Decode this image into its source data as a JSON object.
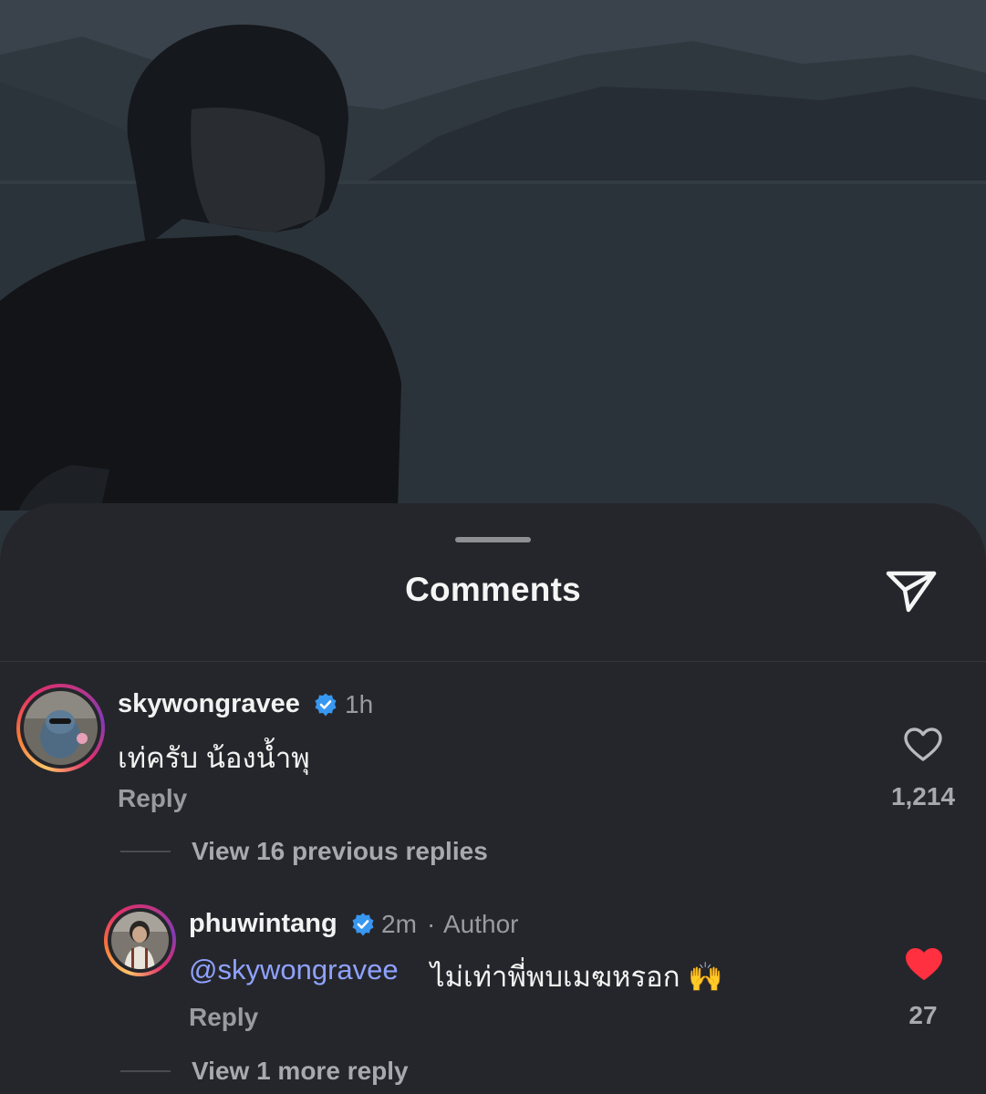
{
  "sheet": {
    "title": "Comments"
  },
  "icons": {
    "share": "paper-plane-icon",
    "like": "heart-icon",
    "verified": "verified-badge-icon",
    "grabber": "drag-handle"
  },
  "colors": {
    "sheet_bg": "#25262b",
    "verified_blue": "#3897f0",
    "liked_red": "#ff3040",
    "mention_blue": "#8ea2ff",
    "muted_text": "#9a9ba0"
  },
  "comments": [
    {
      "username": "skywongravee",
      "verified": true,
      "time": "1h",
      "text": "เท่ครับ น้องน้ำพุ",
      "reply_label": "Reply",
      "like_count": "1,214",
      "liked": false,
      "view_replies": "View 16 previous replies"
    }
  ],
  "reply": {
    "username": "phuwintang",
    "verified": true,
    "time": "2m",
    "separator": "·",
    "role": "Author",
    "mention": "@skywongravee",
    "text": "ไม่เท่าพี่พบเมฆหรอก 🙌",
    "reply_label": "Reply",
    "like_count": "27",
    "liked": true,
    "view_more": "View 1 more reply"
  }
}
